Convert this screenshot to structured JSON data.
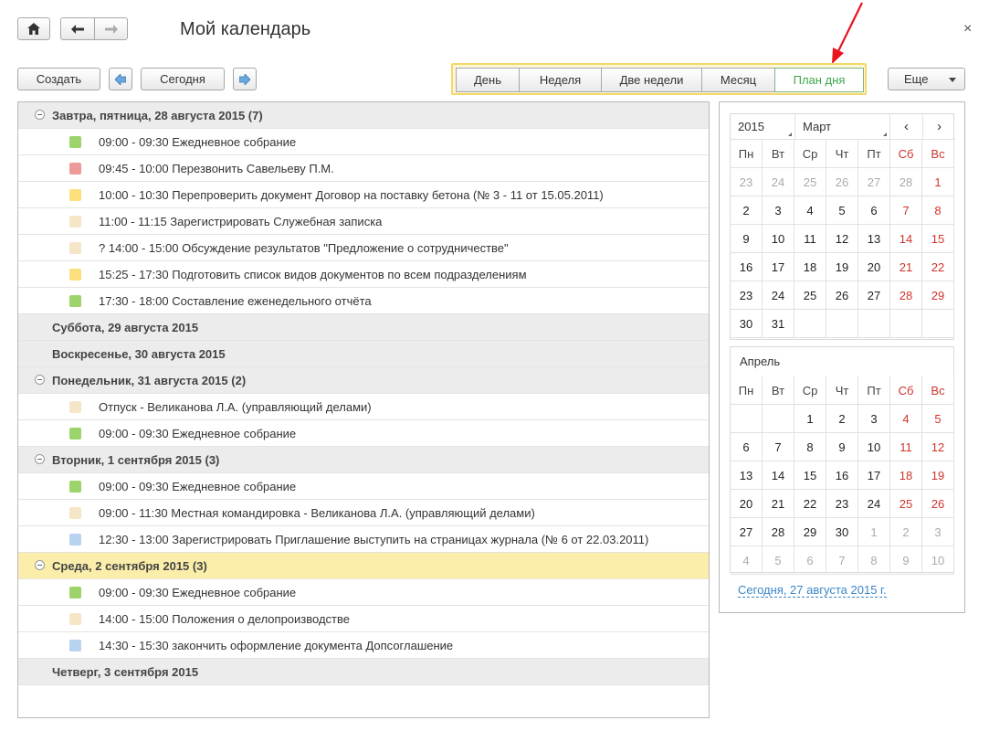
{
  "title": "Мой календарь",
  "close_glyph": "×",
  "toolbar": {
    "create": "Создать",
    "today": "Сегодня",
    "more": "Еще"
  },
  "views": [
    {
      "label": "День",
      "active": false
    },
    {
      "label": "Неделя",
      "active": false
    },
    {
      "label": "Две недели",
      "active": false
    },
    {
      "label": "Месяц",
      "active": false
    },
    {
      "label": "План дня",
      "active": true
    }
  ],
  "colors": {
    "green": "#9cd36b",
    "red": "#ef9a9a",
    "yellow": "#fbe07c",
    "beige": "#f6e6c8",
    "blue": "#b7d3f0",
    "accent_yellow": "#f3d86a",
    "weekend": "#d0342c",
    "link": "#3a87c8"
  },
  "agenda": [
    {
      "type": "group",
      "label": "Завтра, пятница, 28 августа 2015 (7)",
      "expandable": true,
      "current": false
    },
    {
      "type": "item",
      "color": "green",
      "label": "09:00 - 09:30 Ежедневное собрание"
    },
    {
      "type": "item",
      "color": "red",
      "label": "09:45 - 10:00 Перезвонить Савельеву П.М."
    },
    {
      "type": "item",
      "color": "yellow",
      "label": "10:00 - 10:30 Перепроверить документ Договор на поставку бетона (№ 3 - 11 от 15.05.2011)"
    },
    {
      "type": "item",
      "color": "beige",
      "label": "11:00 - 11:15 Зарегистрировать Служебная записка"
    },
    {
      "type": "item",
      "color": "beige",
      "label": "? 14:00 - 15:00 Обсуждение результатов \"Предложение о сотрудничестве\""
    },
    {
      "type": "item",
      "color": "yellow",
      "label": "15:25 - 17:30 Подготовить список видов документов по всем подразделениям"
    },
    {
      "type": "item",
      "color": "green",
      "label": "17:30 - 18:00 Составление еженедельного отчёта"
    },
    {
      "type": "group",
      "label": "Суббота, 29 августа 2015",
      "expandable": false,
      "current": false
    },
    {
      "type": "group",
      "label": "Воскресенье, 30 августа 2015",
      "expandable": false,
      "current": false
    },
    {
      "type": "group",
      "label": "Понедельник, 31 августа 2015 (2)",
      "expandable": true,
      "current": false
    },
    {
      "type": "item",
      "color": "beige",
      "label": "Отпуск - Великанова Л.А. (управляющий делами)"
    },
    {
      "type": "item",
      "color": "green",
      "label": "09:00 - 09:30 Ежедневное собрание"
    },
    {
      "type": "group",
      "label": "Вторник, 1 сентября 2015 (3)",
      "expandable": true,
      "current": false
    },
    {
      "type": "item",
      "color": "green",
      "label": "09:00 - 09:30 Ежедневное собрание"
    },
    {
      "type": "item",
      "color": "beige",
      "label": "09:00 - 11:30 Местная командировка - Великанова Л.А. (управляющий делами)"
    },
    {
      "type": "item",
      "color": "blue",
      "label": "12:30 - 13:00 Зарегистрировать Приглашение выступить на страницах журнала (№ 6 от 22.03.2011)"
    },
    {
      "type": "group",
      "label": "Среда, 2 сентября 2015 (3)",
      "expandable": true,
      "current": true
    },
    {
      "type": "item",
      "color": "green",
      "label": "09:00 - 09:30 Ежедневное собрание"
    },
    {
      "type": "item",
      "color": "beige",
      "label": "14:00 - 15:00 Положения о делопроизводстве"
    },
    {
      "type": "item",
      "color": "blue",
      "label": "14:30 - 15:30 закончить оформление документа Допсоглашение"
    },
    {
      "type": "group",
      "label": "Четверг, 3 сентября 2015",
      "expandable": false,
      "current": false
    }
  ],
  "calendar": {
    "year": "2015",
    "month_select": "Март",
    "prev_glyph": "‹",
    "next_glyph": "›",
    "weekdays": [
      "Пн",
      "Вт",
      "Ср",
      "Чт",
      "Пт",
      "Сб",
      "Вс"
    ],
    "march_weeks": [
      [
        [
          "23",
          "dim"
        ],
        [
          "24",
          "dim"
        ],
        [
          "25",
          "dim"
        ],
        [
          "26",
          "dim"
        ],
        [
          "27",
          "dim"
        ],
        [
          "28",
          "dim"
        ],
        [
          "1",
          "weekend"
        ]
      ],
      [
        [
          "2",
          ""
        ],
        [
          "3",
          ""
        ],
        [
          "4",
          ""
        ],
        [
          "5",
          ""
        ],
        [
          "6",
          ""
        ],
        [
          "7",
          "weekend"
        ],
        [
          "8",
          "weekend"
        ]
      ],
      [
        [
          "9",
          ""
        ],
        [
          "10",
          ""
        ],
        [
          "11",
          ""
        ],
        [
          "12",
          ""
        ],
        [
          "13",
          ""
        ],
        [
          "14",
          "weekend"
        ],
        [
          "15",
          "weekend"
        ]
      ],
      [
        [
          "16",
          ""
        ],
        [
          "17",
          ""
        ],
        [
          "18",
          ""
        ],
        [
          "19",
          ""
        ],
        [
          "20",
          ""
        ],
        [
          "21",
          "weekend"
        ],
        [
          "22",
          "weekend"
        ]
      ],
      [
        [
          "23",
          ""
        ],
        [
          "24",
          ""
        ],
        [
          "25",
          ""
        ],
        [
          "26",
          ""
        ],
        [
          "27",
          ""
        ],
        [
          "28",
          "weekend"
        ],
        [
          "29",
          "weekend"
        ]
      ],
      [
        [
          "30",
          ""
        ],
        [
          "31",
          ""
        ],
        [
          "",
          ""
        ],
        [
          "",
          ""
        ],
        [
          "",
          ""
        ],
        [
          "",
          ""
        ],
        [
          "",
          ""
        ]
      ]
    ],
    "second_month_label": "Апрель",
    "april_weeks": [
      [
        [
          "",
          ""
        ],
        [
          "",
          ""
        ],
        [
          "1",
          ""
        ],
        [
          "2",
          ""
        ],
        [
          "3",
          ""
        ],
        [
          "4",
          "weekend"
        ],
        [
          "5",
          "weekend"
        ]
      ],
      [
        [
          "6",
          ""
        ],
        [
          "7",
          ""
        ],
        [
          "8",
          ""
        ],
        [
          "9",
          ""
        ],
        [
          "10",
          ""
        ],
        [
          "11",
          "weekend"
        ],
        [
          "12",
          "weekend"
        ]
      ],
      [
        [
          "13",
          ""
        ],
        [
          "14",
          ""
        ],
        [
          "15",
          ""
        ],
        [
          "16",
          ""
        ],
        [
          "17",
          ""
        ],
        [
          "18",
          "weekend"
        ],
        [
          "19",
          "weekend"
        ]
      ],
      [
        [
          "20",
          ""
        ],
        [
          "21",
          ""
        ],
        [
          "22",
          ""
        ],
        [
          "23",
          ""
        ],
        [
          "24",
          ""
        ],
        [
          "25",
          "weekend"
        ],
        [
          "26",
          "weekend"
        ]
      ],
      [
        [
          "27",
          ""
        ],
        [
          "28",
          ""
        ],
        [
          "29",
          ""
        ],
        [
          "30",
          ""
        ],
        [
          "1",
          "dim"
        ],
        [
          "2",
          "dim"
        ],
        [
          "3",
          "dim"
        ]
      ],
      [
        [
          "4",
          "dim"
        ],
        [
          "5",
          "dim"
        ],
        [
          "6",
          "dim"
        ],
        [
          "7",
          "dim"
        ],
        [
          "8",
          "dim"
        ],
        [
          "9",
          "dim"
        ],
        [
          "10",
          "dim"
        ]
      ]
    ],
    "today_link": "Сегодня, 27 августа 2015 г."
  }
}
